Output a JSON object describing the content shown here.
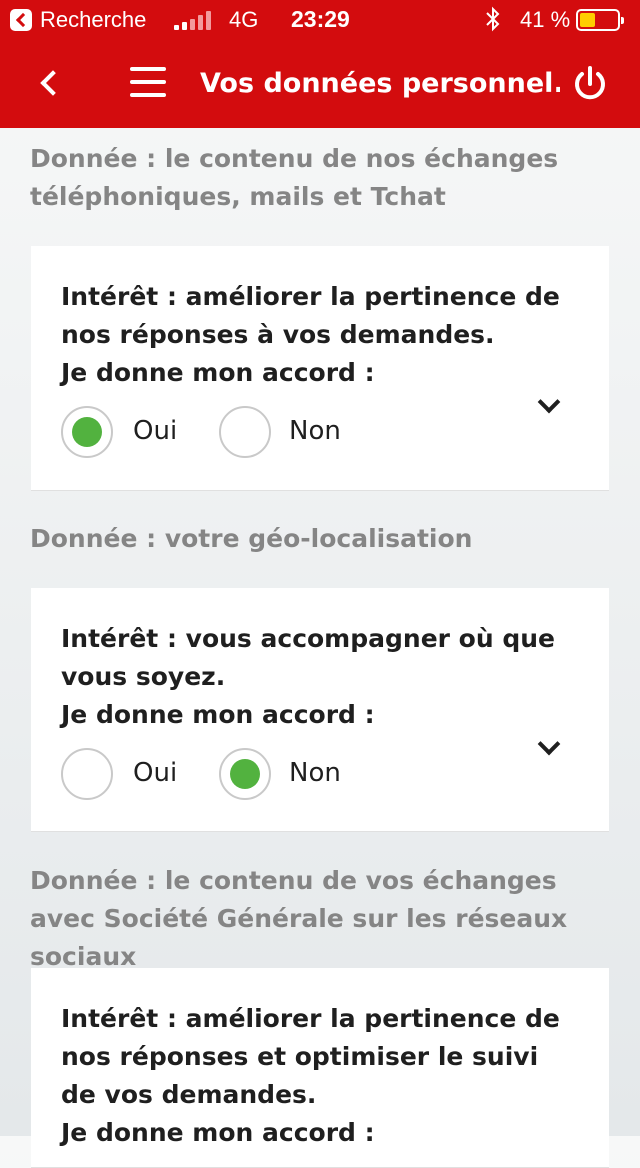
{
  "status_bar": {
    "back_app": "Recherche",
    "network": "4G",
    "time": "23:29",
    "bluetooth_icon": "bluetooth-icon",
    "battery_percent": "41 %",
    "battery_level": 0.41,
    "battery_color": "#ffcc00"
  },
  "nav": {
    "title": "Vos données personnel...",
    "back_icon": "chevron-left-icon",
    "menu_icon": "hamburger-menu-icon",
    "power_icon": "power-icon",
    "color": "#d30c0e"
  },
  "sections": [
    {
      "title": "Donnée : le contenu de nos échanges téléphoniques, mails et Tchat",
      "interest": "Intérêt : améliorer la pertinence de nos réponses à vos demandes.",
      "consent_label": "Je donne mon accord :",
      "options": [
        "Oui",
        "Non"
      ],
      "selected": "Oui"
    },
    {
      "title": "Donnée : votre géo-localisation",
      "interest": "Intérêt : vous accompagner où que vous soyez.",
      "consent_label": "Je donne mon accord :",
      "options": [
        "Oui",
        "Non"
      ],
      "selected": "Non"
    },
    {
      "title": "Donnée : le contenu de vos échanges avec Société Générale sur les réseaux sociaux",
      "interest": "Intérêt : améliorer la pertinence de nos réponses et optimiser le suivi de vos demandes.",
      "consent_label": "Je donne mon accord :"
    }
  ],
  "accent_green": "#52b23f"
}
